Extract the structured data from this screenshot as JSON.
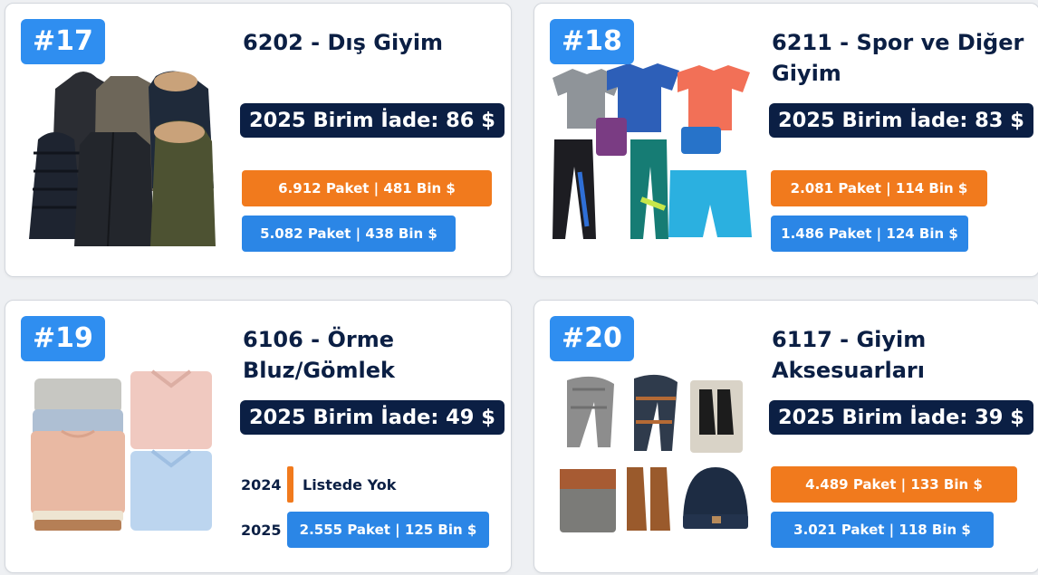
{
  "cards": [
    {
      "rank": "#17",
      "title_line1": "6202 - Dış Giyim",
      "title_line2": "",
      "iade": "2025 Birim İade: 86 $",
      "orange": "6.912 Paket | 481 Bin $",
      "blue": "5.082 Paket | 438 Bin $",
      "image": "outerwear-coats-illustration"
    },
    {
      "rank": "#18",
      "title_line1": "6211 - Spor ve Diğer",
      "title_line2": "Giyim",
      "iade": "2025 Birim İade: 83 $",
      "orange": "2.081 Paket | 114 Bin $",
      "blue": "1.486 Paket | 124 Bin $",
      "image": "sportswear-illustration"
    },
    {
      "rank": "#19",
      "title_line1": "6106 - Örme",
      "title_line2": "Bluz/Gömlek",
      "iade": "2025 Birim İade: 49 $",
      "year_2024": "2024",
      "not_listed": "Listede Yok",
      "year_2025": "2025",
      "blue": "2.555 Paket | 125 Bin $",
      "image": "knit-blouses-shirts-illustration"
    },
    {
      "rank": "#20",
      "title_line1": "6117 - Giyim",
      "title_line2": "Aksesuarları",
      "iade": "2025 Birim İade: 39 $",
      "orange": "4.489 Paket | 133 Bin $",
      "blue": "3.021 Paket | 118 Bin $",
      "image": "clothing-accessories-illustration"
    }
  ],
  "colors": {
    "rank_badge": "#2f8ef0",
    "navy": "#0b1f44",
    "orange": "#f17a1d",
    "blue": "#2b86e6"
  }
}
